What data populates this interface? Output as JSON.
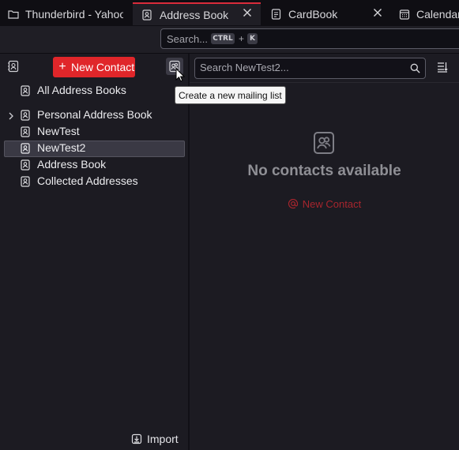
{
  "tabs": [
    {
      "label": "Thunderbird - Yahoo",
      "icon": "folder-icon",
      "active": false
    },
    {
      "label": "Address Book",
      "icon": "address-book-icon",
      "active": true
    },
    {
      "label": "CardBook",
      "icon": "cardbook-icon",
      "active": false
    },
    {
      "label": "Calendar",
      "icon": "calendar-icon",
      "active": false
    }
  ],
  "global_search": {
    "placeholder": "Search...",
    "shortcut_key1": "CTRL",
    "shortcut_plus": "+",
    "shortcut_key2": "K"
  },
  "sidebar": {
    "new_contact_label": "New Contact",
    "books": [
      {
        "label": "All Address Books"
      },
      {
        "label": "Personal Address Book",
        "expandable": true
      },
      {
        "label": "NewTest"
      },
      {
        "label": "NewTest2",
        "selected": true
      },
      {
        "label": "Address Book"
      },
      {
        "label": "Collected Addresses"
      }
    ],
    "import_label": "Import"
  },
  "tooltip": {
    "text": "Create a new mailing list"
  },
  "contacts": {
    "search_placeholder": "Search NewTest2...",
    "empty_title": "No contacts available",
    "empty_new_contact_label": "New Contact"
  },
  "colors": {
    "accent": "#e0262a",
    "tab_indicator": "#d92b3b",
    "background": "#1c1b22"
  }
}
